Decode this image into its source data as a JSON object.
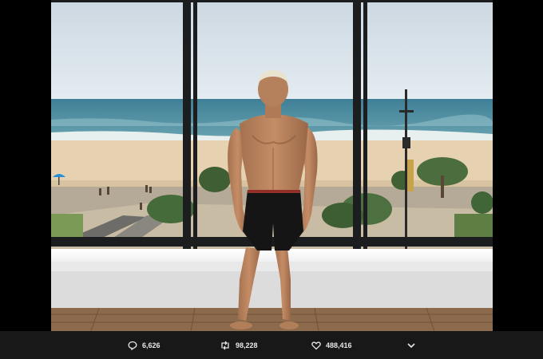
{
  "photo": {
    "subject": "shirtless man in black swim shorts standing by window overlooking beach"
  },
  "actions": {
    "reply_count": "6,626",
    "retweet_count": "98,228",
    "like_count": "488,416"
  },
  "colors": {
    "bar_background": "#181818",
    "icon_color": "#e8e8e8"
  }
}
